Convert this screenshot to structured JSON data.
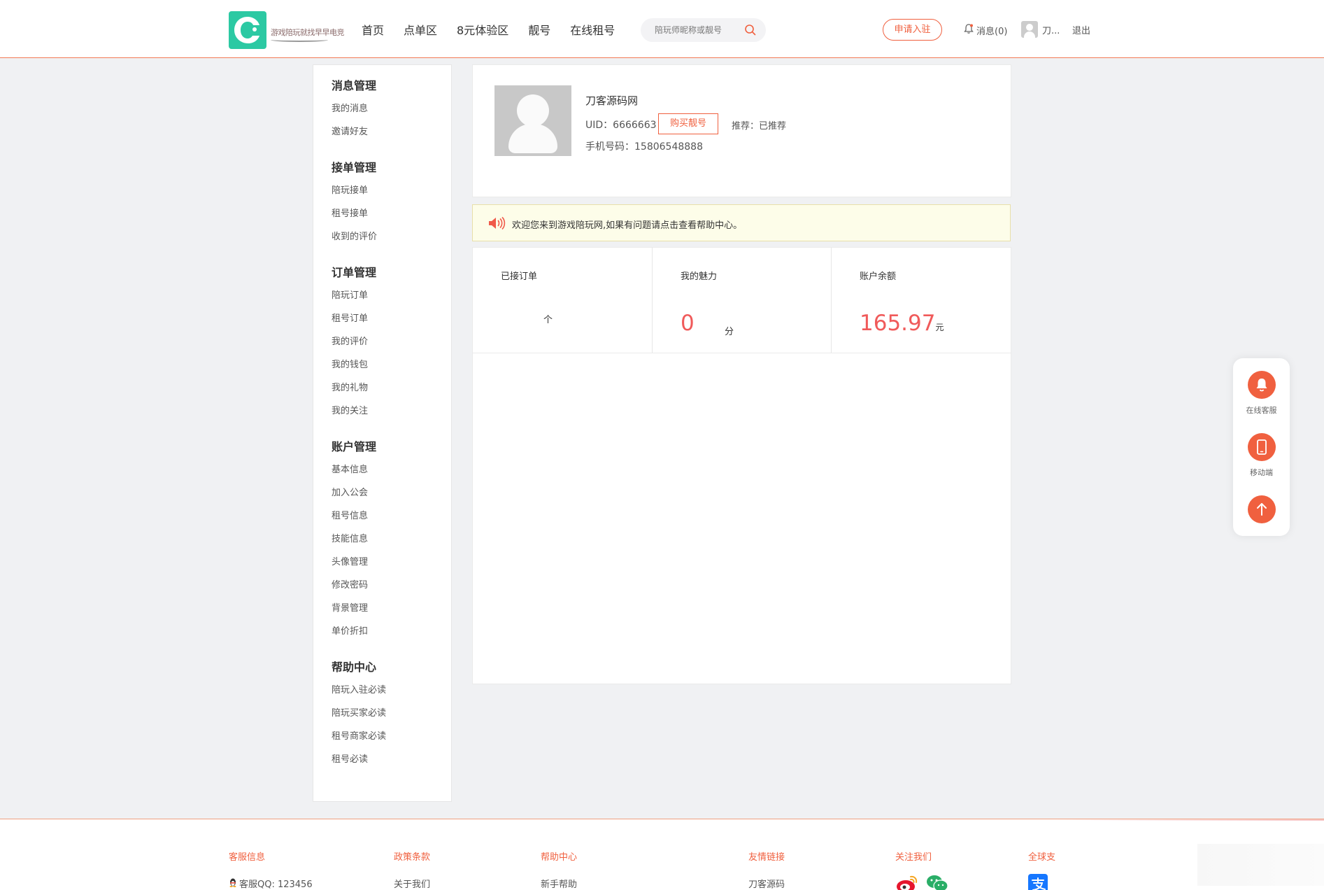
{
  "header": {
    "logo_text": "游戏陪玩就找早早电竞",
    "nav": [
      "首页",
      "点单区",
      "8元体验区",
      "靓号",
      "在线租号"
    ],
    "search_placeholder": "陪玩师昵称或靓号",
    "apply_label": "申请入驻",
    "messages_label": "消息(0)",
    "user_name": "刀...",
    "logout_label": "退出"
  },
  "sidebar": {
    "sections": [
      {
        "title": "消息管理",
        "items": [
          "我的消息",
          "邀请好友"
        ]
      },
      {
        "title": "接单管理",
        "items": [
          "陪玩接单",
          "租号接单",
          "收到的评价"
        ]
      },
      {
        "title": "订单管理",
        "items": [
          "陪玩订单",
          "租号订单",
          "我的评价",
          "我的钱包",
          "我的礼物",
          "我的关注"
        ]
      },
      {
        "title": "账户管理",
        "items": [
          "基本信息",
          "加入公会",
          "租号信息",
          "技能信息",
          "头像管理",
          "修改密码",
          "背景管理",
          "单价折扣"
        ]
      },
      {
        "title": "帮助中心",
        "items": [
          "陪玩入驻必读",
          "陪玩买家必读",
          "租号商家必读",
          "租号必读"
        ]
      }
    ]
  },
  "profile": {
    "name": "刀客源码网",
    "uid": "UID：6666663",
    "buy_label": "购买靓号",
    "recommend": "推荐：已推荐",
    "phone": "手机号码：15806548888"
  },
  "notice": {
    "text": "欢迎您来到游戏陪玩网,如果有问题请点击查看帮助中心。"
  },
  "stats": {
    "orders": {
      "label": "已接订单",
      "unit": "个"
    },
    "charm": {
      "label": "我的魅力",
      "value": "0",
      "unit": "分"
    },
    "balance": {
      "label": "账户余额",
      "value": "165.97",
      "unit": "元"
    }
  },
  "float_panel": {
    "service": "在线客服",
    "mobile": "移动端"
  },
  "footer": {
    "cols": [
      {
        "title": "客服信息",
        "item": "客服QQ: 123456"
      },
      {
        "title": "政策条款",
        "item": "关于我们"
      },
      {
        "title": "帮助中心",
        "item": "新手帮助"
      },
      {
        "title": "友情链接",
        "item": "刀客源码"
      },
      {
        "title": "关注我们"
      },
      {
        "title": "全球支"
      }
    ]
  },
  "colors": {
    "accent": "#f0603f",
    "number": "#f05a5a",
    "logo": "#2cc9a3",
    "notice_bg": "#fdfde9"
  }
}
